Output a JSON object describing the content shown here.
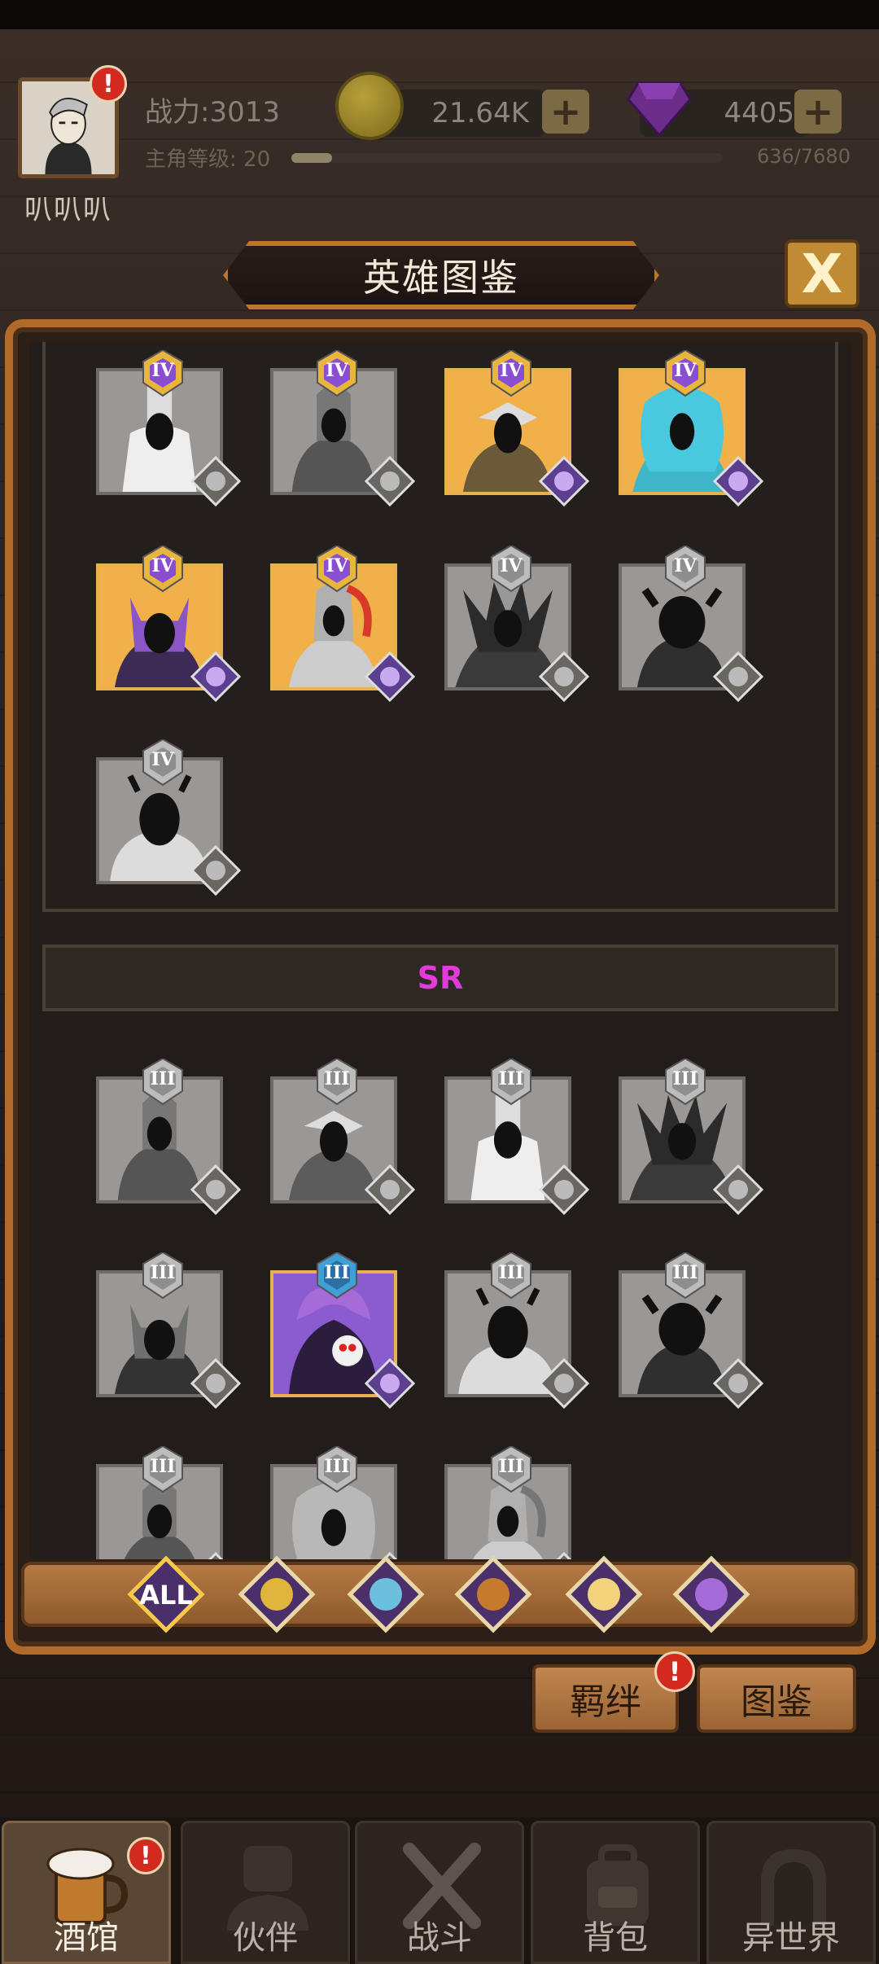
{
  "header": {
    "power": "战力:3013",
    "level_label": "主角等级: 20",
    "level_progress": 0.094,
    "exp": "636/7680",
    "player_name": "叭叭叭",
    "gold": "21.64K",
    "gems": "4405",
    "alert_mark": "!"
  },
  "panel": {
    "title": "英雄图鉴",
    "close_label": "X",
    "sr_label": "SR"
  },
  "rank_labels": {
    "iv": "IV",
    "iii": "III"
  },
  "filter": {
    "all_label": "ALL"
  },
  "actions": {
    "bond_label": "羁绊",
    "codex_label": "图鉴",
    "alert_mark": "!"
  },
  "nav": {
    "tavern": "酒馆",
    "partner": "伙伴",
    "battle": "战斗",
    "bag": "背包",
    "otherworld": "异世界",
    "alert_mark": "!"
  },
  "colors": {
    "accent_orange": "#b26a2b",
    "sr_magenta": "#e23bd9",
    "owned_gold": "#f0b14a",
    "owned_purple": "#8b5bd0"
  }
}
